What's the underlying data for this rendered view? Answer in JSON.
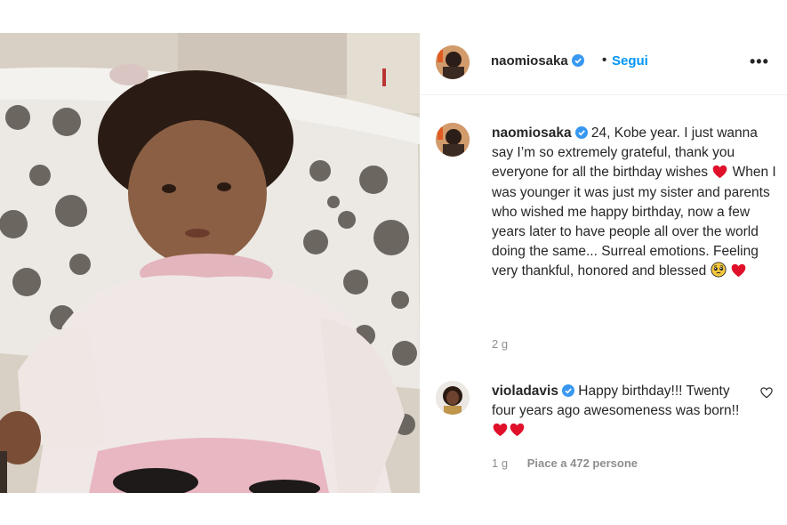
{
  "post": {
    "username": "naomiosaka",
    "separator": "•",
    "follow_label": "Segui",
    "more_label": "•••",
    "caption_parts": [
      "24, Kobe year. I just wanna say I’m so extremely grateful, thank you everyone for all the birthday wishes",
      "When I was younger it was just my sister and parents who wished me happy birthday, now a few years later to have people all over the world doing the same... Surreal emotions. Feeling very thankful, honored and blessed"
    ],
    "time": "2 g"
  },
  "comment": {
    "username": "violadavis",
    "text": "Happy birthday!!! Twenty four years ago awesomeness was born!!",
    "time": "1 g",
    "likes_label": "Piace a 472 persone"
  },
  "icons": {
    "verified": "verified-badge-icon",
    "heart": "red-heart-emoji",
    "pleading": "pleading-face-emoji",
    "like": "heart-outline-icon",
    "more": "more-options-icon"
  },
  "colors": {
    "accent": "#0095f6",
    "verified": "#3897f0",
    "heart": "#e0102a",
    "muted": "#8e8e8e"
  }
}
